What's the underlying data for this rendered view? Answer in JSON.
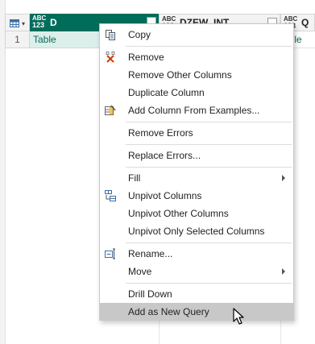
{
  "grid": {
    "corner_icon": "table-icon",
    "columns": [
      {
        "type_top": "ABC",
        "type_bottom": "123",
        "name": "D",
        "selected": true
      },
      {
        "type_top": "ABC",
        "type_bottom": "123",
        "name": "DZEW_INT",
        "selected": false
      },
      {
        "type_top": "ABC",
        "type_bottom": "123",
        "name": "Q",
        "selected": false
      }
    ],
    "rows": [
      {
        "num": "1",
        "cells": [
          "Table",
          "",
          "able"
        ]
      }
    ]
  },
  "menu": {
    "items": [
      {
        "label": "Copy",
        "icon": "copy-icon"
      },
      {
        "label": "Remove",
        "icon": "remove-icon"
      },
      {
        "label": "Remove Other Columns"
      },
      {
        "label": "Duplicate Column"
      },
      {
        "label": "Add Column From Examples...",
        "icon": "column-examples-icon"
      },
      {
        "label": "Remove Errors"
      },
      {
        "label": "Replace Errors..."
      },
      {
        "label": "Fill",
        "submenu": true
      },
      {
        "label": "Unpivot Columns",
        "icon": "unpivot-icon"
      },
      {
        "label": "Unpivot Other Columns"
      },
      {
        "label": "Unpivot Only Selected Columns"
      },
      {
        "label": "Rename...",
        "icon": "rename-icon"
      },
      {
        "label": "Move",
        "submenu": true
      },
      {
        "label": "Drill Down"
      },
      {
        "label": "Add as New Query",
        "highlighted": true
      }
    ]
  },
  "colors": {
    "selected_header": "#006c5a",
    "selected_cell": "#dcefeb",
    "highlight": "#c8c8c8"
  }
}
